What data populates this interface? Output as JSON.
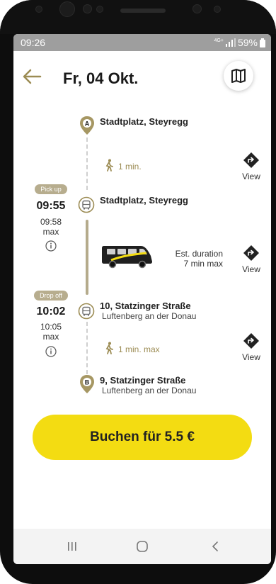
{
  "status": {
    "time": "09:26",
    "network": "4G+",
    "battery": "59%"
  },
  "header": {
    "title": "Fr, 04 Okt."
  },
  "route": {
    "start": {
      "marker": "A",
      "name": "Stadtplatz, Steyregg"
    },
    "walk1": {
      "text": "1 min."
    },
    "pickup": {
      "badge": "Pick up",
      "time": "09:55",
      "max_time": "09:58",
      "max_label": "max",
      "name": "Stadtplatz, Steyregg"
    },
    "ride": {
      "duration_label": "Est. duration",
      "duration_value": "7 min max"
    },
    "dropoff": {
      "badge": "Drop off",
      "time": "10:02",
      "max_time": "10:05",
      "max_label": "max",
      "name": "10, Statzinger Straße",
      "sub": "Luftenberg an der Donau"
    },
    "walk2": {
      "text": "1 min. max"
    },
    "end": {
      "marker": "B",
      "name": "9, Statzinger Straße",
      "sub": "Luftenberg an der Donau"
    },
    "view_label": "View"
  },
  "book": {
    "label": "Buchen für 5.5 €"
  },
  "colors": {
    "accent": "#f3dc12",
    "gold": "#9c8c54",
    "badge": "#b7ad8e"
  }
}
